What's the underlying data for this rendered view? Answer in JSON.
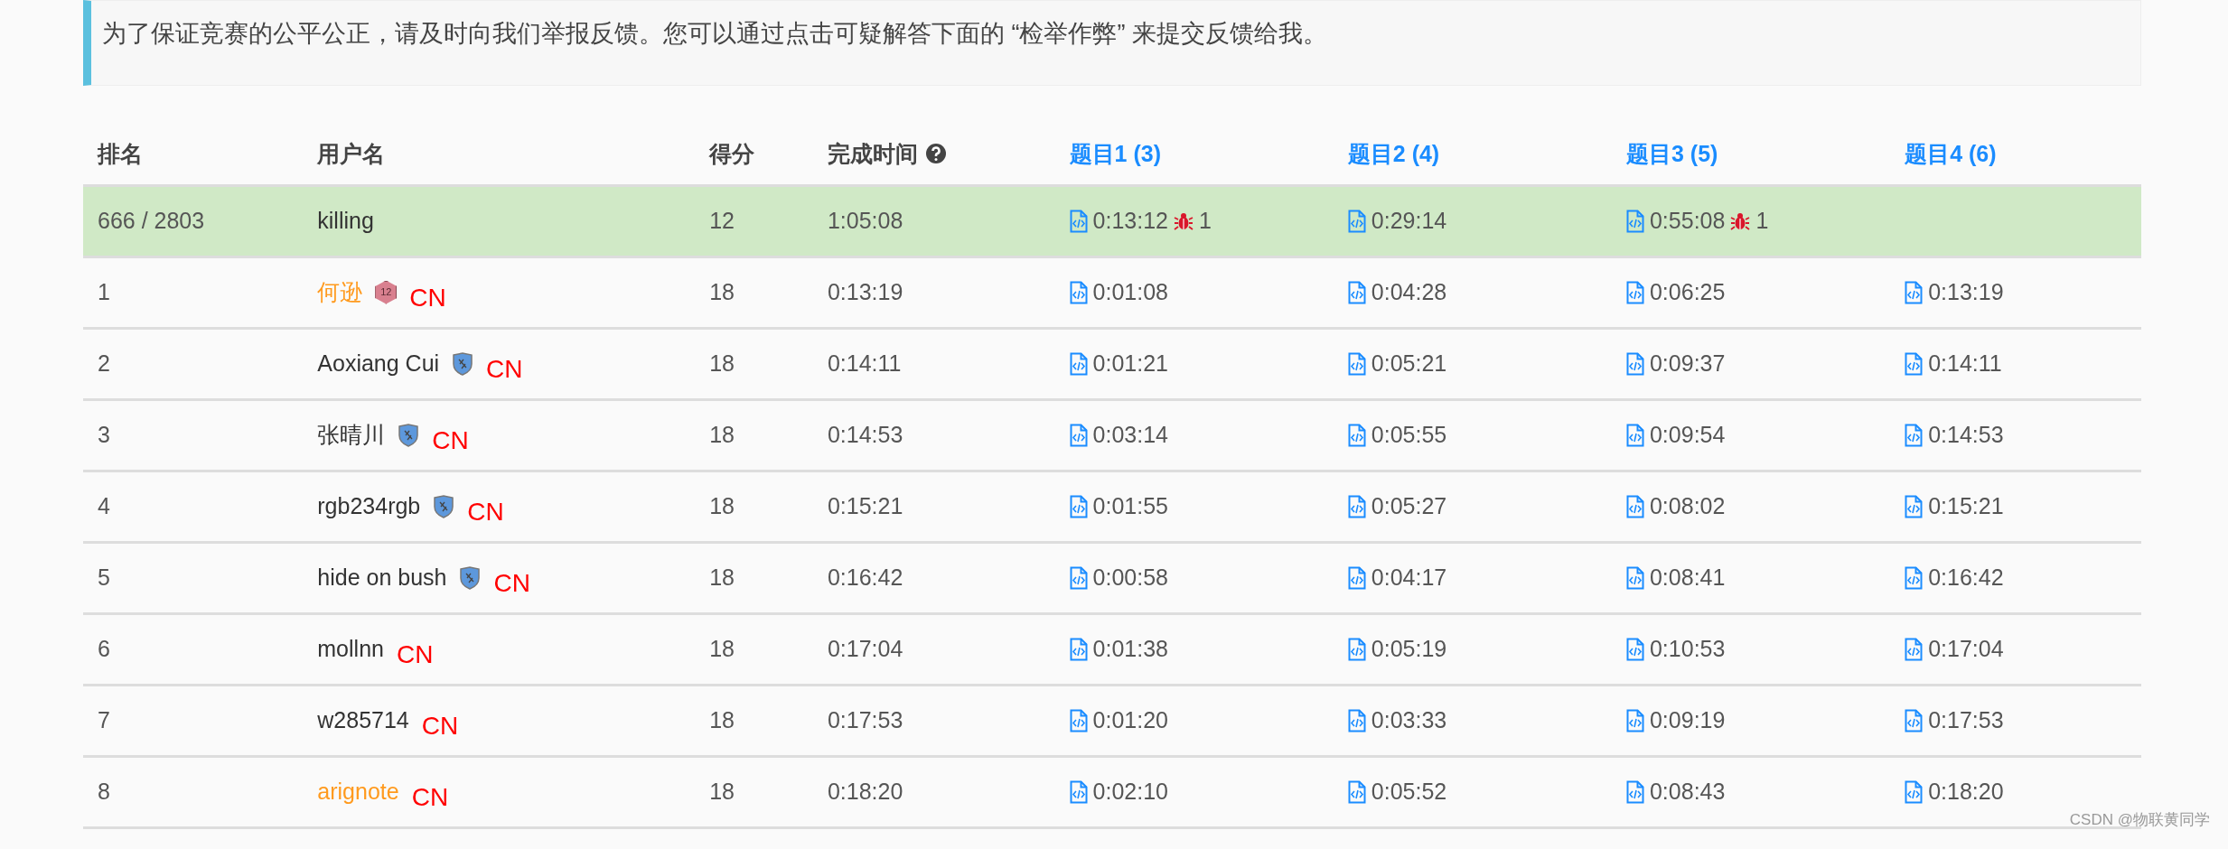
{
  "notice": {
    "text": "为了保证竞赛的公平公正，请及时向我们举报反馈。您可以通过点击可疑解答下面的 “检举作弊” 来提交反馈给我。"
  },
  "table": {
    "columns": [
      {
        "label": "排名",
        "kind": "plain"
      },
      {
        "label": "用户名",
        "kind": "plain"
      },
      {
        "label": "得分",
        "kind": "plain"
      },
      {
        "label": "完成时间",
        "kind": "help"
      },
      {
        "label": "题目1 (3)",
        "kind": "problem"
      },
      {
        "label": "题目2 (4)",
        "kind": "problem"
      },
      {
        "label": "题目3 (5)",
        "kind": "problem"
      },
      {
        "label": "题目4 (6)",
        "kind": "problem"
      }
    ],
    "rows": [
      {
        "rank": "666 / 2803",
        "user": "killing",
        "color": "#333333",
        "score": "12",
        "time": "1:05:08",
        "highlighted": true,
        "problems": [
          {
            "time": "0:13:12",
            "wrong": "1"
          },
          {
            "time": "0:29:14"
          },
          {
            "time": "0:55:08",
            "wrong": "1"
          }
        ]
      },
      {
        "rank": "1",
        "user": "何逊",
        "color": "#ff9a1e",
        "badge": {
          "kind": "level",
          "text": "12"
        },
        "country": "CN",
        "score": "18",
        "time": "0:13:19",
        "highlighted": false,
        "problems": [
          {
            "time": "0:01:08"
          },
          {
            "time": "0:04:28"
          },
          {
            "time": "0:06:25"
          },
          {
            "time": "0:13:19"
          }
        ]
      },
      {
        "rank": "2",
        "user": "Aoxiang Cui",
        "color": "#333333",
        "badge": {
          "kind": "shield"
        },
        "country": "CN",
        "score": "18",
        "time": "0:14:11",
        "highlighted": false,
        "problems": [
          {
            "time": "0:01:21"
          },
          {
            "time": "0:05:21"
          },
          {
            "time": "0:09:37"
          },
          {
            "time": "0:14:11"
          }
        ]
      },
      {
        "rank": "3",
        "user": "张晴川",
        "color": "#333333",
        "badge": {
          "kind": "shield"
        },
        "country": "CN",
        "score": "18",
        "time": "0:14:53",
        "highlighted": false,
        "problems": [
          {
            "time": "0:03:14"
          },
          {
            "time": "0:05:55"
          },
          {
            "time": "0:09:54"
          },
          {
            "time": "0:14:53"
          }
        ]
      },
      {
        "rank": "4",
        "user": "rgb234rgb",
        "color": "#333333",
        "badge": {
          "kind": "shield"
        },
        "country": "CN",
        "score": "18",
        "time": "0:15:21",
        "highlighted": false,
        "problems": [
          {
            "time": "0:01:55"
          },
          {
            "time": "0:05:27"
          },
          {
            "time": "0:08:02"
          },
          {
            "time": "0:15:21"
          }
        ]
      },
      {
        "rank": "5",
        "user": "hide on bush",
        "color": "#333333",
        "badge": {
          "kind": "shield"
        },
        "country": "CN",
        "score": "18",
        "time": "0:16:42",
        "highlighted": false,
        "problems": [
          {
            "time": "0:00:58"
          },
          {
            "time": "0:04:17"
          },
          {
            "time": "0:08:41"
          },
          {
            "time": "0:16:42"
          }
        ]
      },
      {
        "rank": "6",
        "user": "mollnn",
        "color": "#333333",
        "country": "CN",
        "score": "18",
        "time": "0:17:04",
        "highlighted": false,
        "problems": [
          {
            "time": "0:01:38"
          },
          {
            "time": "0:05:19"
          },
          {
            "time": "0:10:53"
          },
          {
            "time": "0:17:04"
          }
        ]
      },
      {
        "rank": "7",
        "user": "w285714",
        "color": "#333333",
        "country": "CN",
        "score": "18",
        "time": "0:17:53",
        "highlighted": false,
        "problems": [
          {
            "time": "0:01:20"
          },
          {
            "time": "0:03:33"
          },
          {
            "time": "0:09:19"
          },
          {
            "time": "0:17:53"
          }
        ]
      },
      {
        "rank": "8",
        "user": "arignote",
        "color": "#ff9a1e",
        "country": "CN",
        "score": "18",
        "time": "0:18:20",
        "highlighted": false,
        "problems": [
          {
            "time": "0:02:10"
          },
          {
            "time": "0:05:52"
          },
          {
            "time": "0:08:43"
          },
          {
            "time": "0:18:20"
          }
        ]
      }
    ]
  },
  "watermark": "CSDN @物联黄同学"
}
